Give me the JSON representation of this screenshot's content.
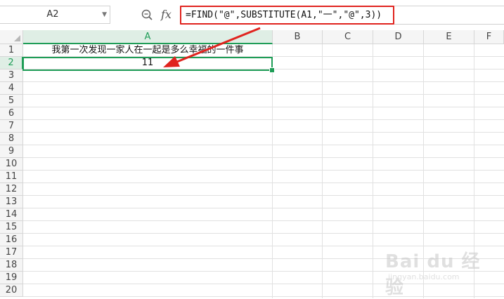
{
  "formula_bar": {
    "name_box": "A2",
    "fx_label": "fx",
    "formula": "=FIND(\"@\",SUBSTITUTE(A1,\"一\",\"@\",3))"
  },
  "columns": [
    "A",
    "B",
    "C",
    "D",
    "E",
    "F"
  ],
  "rows": [
    "1",
    "2",
    "3",
    "4",
    "5",
    "6",
    "7",
    "8",
    "9",
    "10",
    "11",
    "12",
    "13",
    "14",
    "15",
    "16",
    "17",
    "18",
    "19",
    "20"
  ],
  "cells": {
    "A1": "我第一次发现一家人在一起是多么幸福的一件事",
    "A2": "11"
  },
  "selected_cell": "A2",
  "colors": {
    "selection": "#1f9d57",
    "annotation": "#e0231e"
  },
  "watermark": {
    "brand": "Bai du 经验",
    "url": "jingyan.baidu.com"
  }
}
